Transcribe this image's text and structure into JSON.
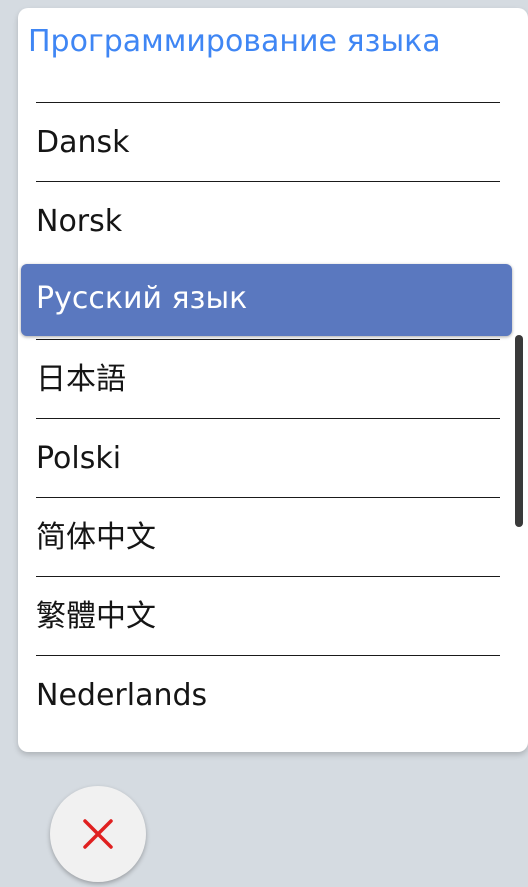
{
  "dialog": {
    "title": "Программирование языка",
    "accent_color": "#3f86f4",
    "selected_color": "#5a78bf"
  },
  "languages": [
    {
      "label": "Dansk",
      "selected": false
    },
    {
      "label": "Norsk",
      "selected": false
    },
    {
      "label": "Русский язык",
      "selected": true
    },
    {
      "label": "日本語",
      "selected": false
    },
    {
      "label": "Polski",
      "selected": false
    },
    {
      "label": "简体中文",
      "selected": false
    },
    {
      "label": "繁體中文",
      "selected": false
    },
    {
      "label": "Nederlands",
      "selected": false
    }
  ],
  "close_button": {
    "icon": "close-icon",
    "color": "#e02020"
  }
}
